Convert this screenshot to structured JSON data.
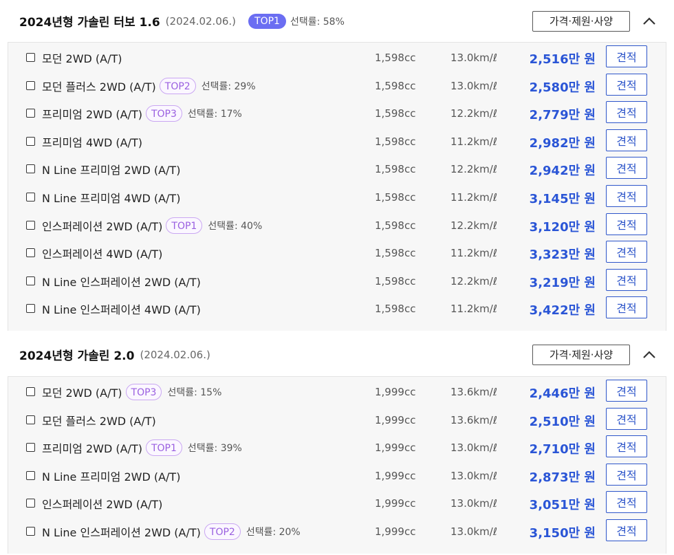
{
  "sections": [
    {
      "title": "2024년형 가솔린 터보 1.6",
      "date": "(2024.02.06.)",
      "badge": "TOP1",
      "rate": "선택률: 58%",
      "spec_button": "가격·제원·사양",
      "rows": [
        {
          "name": "모던 2WD (A/T)",
          "cc": "1,598cc",
          "eff": "13.0km/ℓ",
          "price": "2,516만 원",
          "quote": "견적"
        },
        {
          "name": "모던 플러스 2WD (A/T)",
          "badge": "TOP2",
          "rate": "선택률: 29%",
          "cc": "1,598cc",
          "eff": "13.0km/ℓ",
          "price": "2,580만 원",
          "quote": "견적"
        },
        {
          "name": "프리미엄 2WD (A/T)",
          "badge": "TOP3",
          "rate": "선택률: 17%",
          "cc": "1,598cc",
          "eff": "12.2km/ℓ",
          "price": "2,779만 원",
          "quote": "견적"
        },
        {
          "name": "프리미엄 4WD (A/T)",
          "cc": "1,598cc",
          "eff": "11.2km/ℓ",
          "price": "2,982만 원",
          "quote": "견적"
        },
        {
          "name": "N Line 프리미엄 2WD (A/T)",
          "cc": "1,598cc",
          "eff": "12.2km/ℓ",
          "price": "2,942만 원",
          "quote": "견적"
        },
        {
          "name": "N Line 프리미엄 4WD (A/T)",
          "cc": "1,598cc",
          "eff": "11.2km/ℓ",
          "price": "3,145만 원",
          "quote": "견적"
        },
        {
          "name": "인스퍼레이션 2WD (A/T)",
          "badge": "TOP1",
          "rate": "선택률: 40%",
          "cc": "1,598cc",
          "eff": "12.2km/ℓ",
          "price": "3,120만 원",
          "quote": "견적"
        },
        {
          "name": "인스퍼레이션 4WD (A/T)",
          "cc": "1,598cc",
          "eff": "11.2km/ℓ",
          "price": "3,323만 원",
          "quote": "견적"
        },
        {
          "name": "N Line 인스퍼레이션 2WD (A/T)",
          "cc": "1,598cc",
          "eff": "12.2km/ℓ",
          "price": "3,219만 원",
          "quote": "견적"
        },
        {
          "name": "N Line 인스퍼레이션 4WD (A/T)",
          "cc": "1,598cc",
          "eff": "11.2km/ℓ",
          "price": "3,422만 원",
          "quote": "견적"
        }
      ]
    },
    {
      "title": "2024년형 가솔린 2.0",
      "date": "(2024.02.06.)",
      "spec_button": "가격·제원·사양",
      "rows": [
        {
          "name": "모던 2WD (A/T)",
          "badge": "TOP3",
          "rate": "선택률: 15%",
          "cc": "1,999cc",
          "eff": "13.6km/ℓ",
          "price": "2,446만 원",
          "quote": "견적"
        },
        {
          "name": "모던 플러스 2WD (A/T)",
          "cc": "1,999cc",
          "eff": "13.6km/ℓ",
          "price": "2,510만 원",
          "quote": "견적"
        },
        {
          "name": "프리미엄 2WD (A/T)",
          "badge": "TOP1",
          "rate": "선택률: 39%",
          "cc": "1,999cc",
          "eff": "13.0km/ℓ",
          "price": "2,710만 원",
          "quote": "견적"
        },
        {
          "name": "N Line 프리미엄 2WD (A/T)",
          "cc": "1,999cc",
          "eff": "13.0km/ℓ",
          "price": "2,873만 원",
          "quote": "견적"
        },
        {
          "name": "인스퍼레이션 2WD (A/T)",
          "cc": "1,999cc",
          "eff": "13.0km/ℓ",
          "price": "3,051만 원",
          "quote": "견적"
        },
        {
          "name": "N Line 인스퍼레이션 2WD (A/T)",
          "badge": "TOP2",
          "rate": "선택률: 20%",
          "cc": "1,999cc",
          "eff": "13.0km/ℓ",
          "price": "3,150만 원",
          "quote": "견적"
        }
      ]
    }
  ]
}
